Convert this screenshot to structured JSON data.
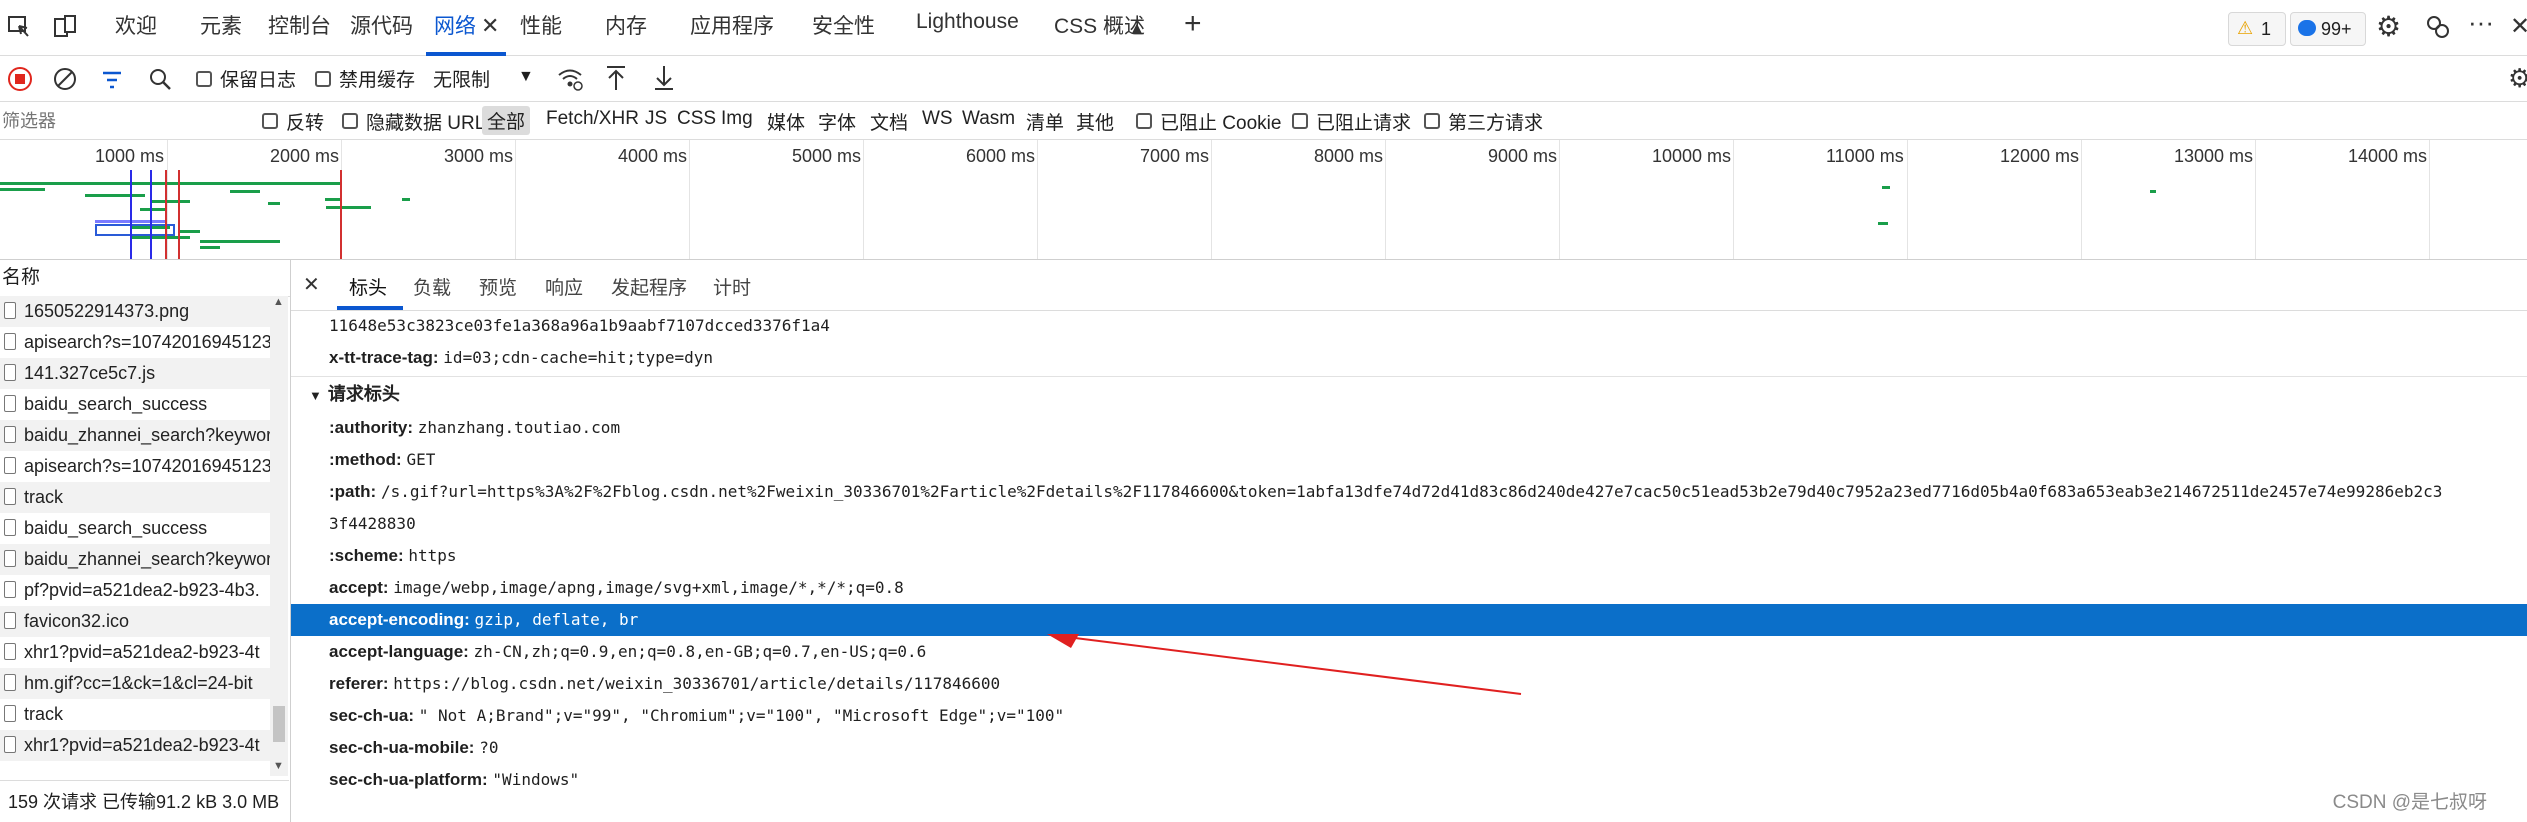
{
  "devtools_tabs": [
    "欢迎",
    "元素",
    "控制台",
    "源代码",
    "网络",
    "性能",
    "内存",
    "应用程序",
    "安全性",
    "Lighthouse",
    "CSS 概述"
  ],
  "active_tab": "网络",
  "warnings_count": "1",
  "messages_count": "99+",
  "toolbar": {
    "preserve_log": "保留日志",
    "disable_cache": "禁用缓存",
    "throttle": "无限制"
  },
  "filter": {
    "placeholder": "筛选器",
    "invert": "反转",
    "hide_data_urls": "隐藏数据 URL",
    "types": [
      "全部",
      "Fetch/XHR",
      "JS",
      "CSS",
      "Img",
      "媒体",
      "字体",
      "文档",
      "WS",
      "Wasm",
      "清单",
      "其他"
    ],
    "blocked_cookies": "已阻止 Cookie",
    "blocked_requests": "已阻止请求",
    "third_party": "第三方请求"
  },
  "timeline": {
    "labels": [
      "1000 ms",
      "2000 ms",
      "3000 ms",
      "4000 ms",
      "5000 ms",
      "6000 ms",
      "7000 ms",
      "8000 ms",
      "9000 ms",
      "10000 ms",
      "11000 ms",
      "12000 ms",
      "13000 ms",
      "14000 ms"
    ]
  },
  "request_list": {
    "header": "名称",
    "items": [
      "1650522914373.png",
      "apisearch?s=10742016945123",
      "141.327ce5c7.js",
      "baidu_search_success",
      "baidu_zhannei_search?keywor",
      "apisearch?s=10742016945123",
      "track",
      "baidu_search_success",
      "baidu_zhannei_search?keywor",
      "pf?pvid=a521dea2-b923-4b3.",
      "favicon32.ico",
      "xhr1?pvid=a521dea2-b923-4t",
      "hm.gif?cc=1&ck=1&cl=24-bit",
      "track",
      "xhr1?pvid=a521dea2-b923-4t"
    ],
    "status": "159 次请求  已传输91.2 kB  3.0 MB"
  },
  "detail": {
    "tabs": [
      "标头",
      "负载",
      "预览",
      "响应",
      "发起程序",
      "计时"
    ],
    "active_tab": "标头",
    "lines": [
      {
        "key": "",
        "value": "11648e53c3823ce03fe1a368a96a1b9aabf7107dcced3376f1a4"
      },
      {
        "key": "x-tt-trace-tag:",
        "value": "id=03;cdn-cache=hit;type=dyn"
      }
    ],
    "section_title": "请求标头",
    "headers": [
      {
        "key": ":authority:",
        "value": "zhanzhang.toutiao.com"
      },
      {
        "key": ":method:",
        "value": "GET"
      },
      {
        "key": ":path:",
        "value": "/s.gif?url=https%3A%2F%2Fblog.csdn.net%2Fweixin_30336701%2Farticle%2Fdetails%2F117846600&token=1abfa13dfe74d72d41d83c86d240de427e7cac50c51ead53b2e79d40c7952a23ed7716d05b4a0f683a653eab3e214672511de2457e74e99286eb2c3"
      },
      {
        "key": "",
        "value": "3f4428830"
      },
      {
        "key": ":scheme:",
        "value": "https"
      },
      {
        "key": "accept:",
        "value": "image/webp,image/apng,image/svg+xml,image/*,*/*;q=0.8"
      },
      {
        "key": "accept-encoding:",
        "value": "gzip, deflate, br"
      },
      {
        "key": "accept-language:",
        "value": "zh-CN,zh;q=0.9,en;q=0.8,en-GB;q=0.7,en-US;q=0.6"
      },
      {
        "key": "referer:",
        "value": "https://blog.csdn.net/weixin_30336701/article/details/117846600"
      },
      {
        "key": "sec-ch-ua:",
        "value": "\" Not A;Brand\";v=\"99\", \"Chromium\";v=\"100\", \"Microsoft Edge\";v=\"100\""
      },
      {
        "key": "sec-ch-ua-mobile:",
        "value": "?0"
      },
      {
        "key": "sec-ch-ua-platform:",
        "value": "\"Windows\""
      }
    ]
  },
  "watermark": "CSDN @是七叔呀",
  "colors": {
    "accent": "#0b57d0",
    "highlight": "#0b6fc9",
    "annotation": "#e02020"
  }
}
